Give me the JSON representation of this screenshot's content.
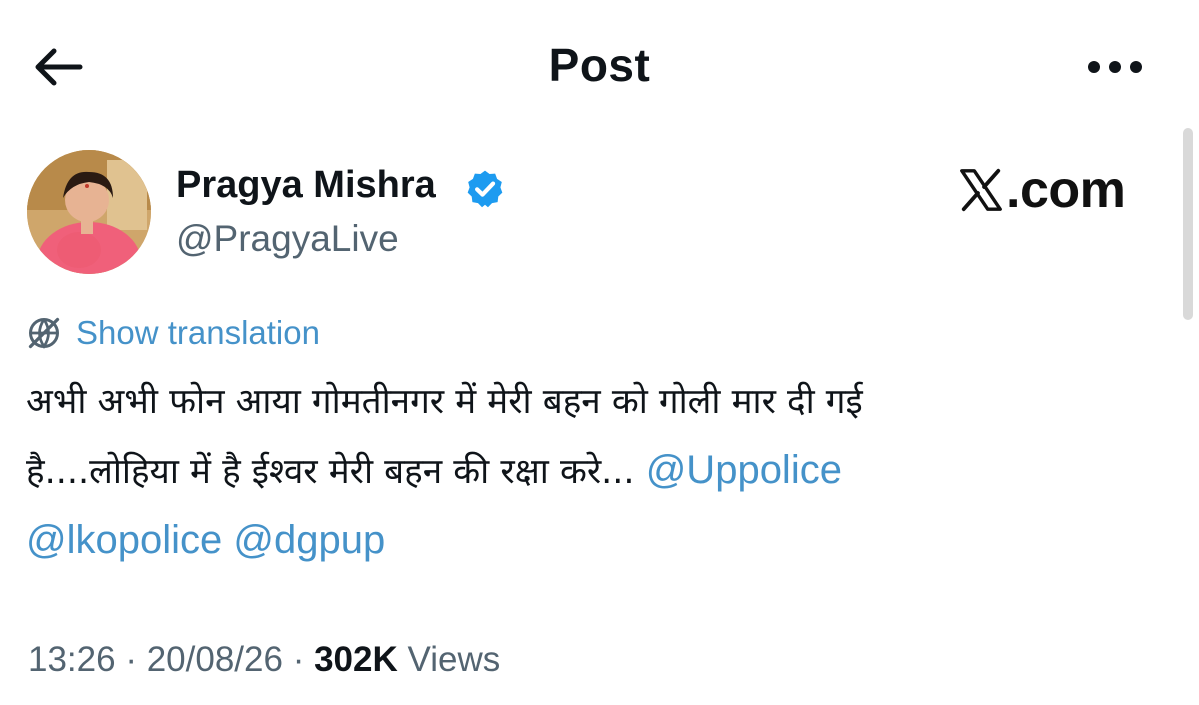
{
  "header": {
    "title": "Post",
    "back_icon": "arrow-left-icon",
    "more_icon": "more-horizontal-icon"
  },
  "author": {
    "name": "Pragya Mishra",
    "handle": "@PragyaLive",
    "verified": true,
    "badge_color": "#1d9bf0"
  },
  "watermark": {
    "text": ".com",
    "logo": "x-logo-icon"
  },
  "translation": {
    "label": "Show translation",
    "icon": "globe-icon"
  },
  "post": {
    "text_line1": "अभी अभी फोन आया गोमतीनगर में मेरी बहन को गोली मार दी गई",
    "text_line2": "है....लोहिया में है ईश्वर मेरी बहन की रक्षा करे...",
    "mentions": [
      "@Uppolice",
      "@lkopolice",
      "@dgpup"
    ]
  },
  "meta": {
    "time": "13:26",
    "separator": "·",
    "date": "20/08/26",
    "views_count": "302K",
    "views_label": "Views"
  },
  "colors": {
    "link": "#4592c9",
    "text": "#0f1419",
    "secondary": "#536471"
  }
}
